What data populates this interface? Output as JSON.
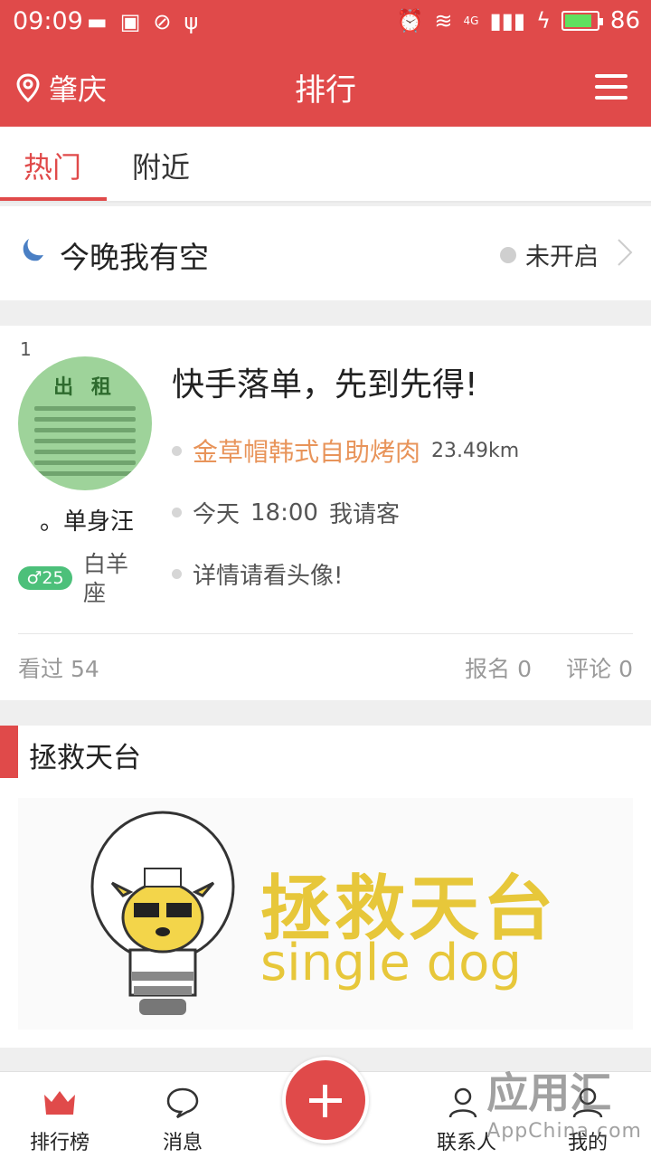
{
  "status_bar": {
    "time": "09:09",
    "network": "4G",
    "battery": "86",
    "battery_level_percent": 86,
    "icons": [
      "message-icon",
      "image-icon",
      "check-circle-icon",
      "usb-icon",
      "alarm-icon",
      "wifi-icon",
      "signal-icon",
      "charging-icon",
      "battery-icon"
    ]
  },
  "header": {
    "city": "肇庆",
    "title": "排行",
    "icons": [
      "location-pin-icon",
      "menu-icon"
    ]
  },
  "tabs": [
    {
      "label": "热门",
      "active": true
    },
    {
      "label": "附近",
      "active": false
    }
  ],
  "tonight": {
    "label": "今晚我有空",
    "status": "未开启"
  },
  "listing": {
    "rank": "1",
    "avatar_text": "出 租",
    "nickname": "。单身汪",
    "gender_age": "♂25",
    "zodiac": "白羊座",
    "headline": "快手落单，先到先得!",
    "place": "金草帽韩式自助烤肉",
    "distance": "23.49km",
    "time_label": "今天",
    "time_value": "18:00",
    "pay": "我请客",
    "note": "详情请看头像!",
    "views": "看过 54",
    "signups": "报名 0",
    "comments": "评论 0"
  },
  "section": {
    "title": "拯救天台",
    "banner_title": "拯救天台",
    "banner_sub": "single dog"
  },
  "bottom_nav": [
    {
      "label": "排行榜",
      "icon": "crown-icon"
    },
    {
      "label": "消息",
      "icon": "chat-bubble-icon"
    },
    {
      "label": "联系人",
      "icon": "contacts-icon"
    },
    {
      "label": "我的",
      "icon": "profile-icon"
    }
  ],
  "watermark": {
    "main": "应用汇",
    "sub": "AppChina.com"
  },
  "colors": {
    "brand": "#e04a4a",
    "place": "#e8945a",
    "banner": "#e7c73a",
    "badge": "#4cc07a"
  }
}
